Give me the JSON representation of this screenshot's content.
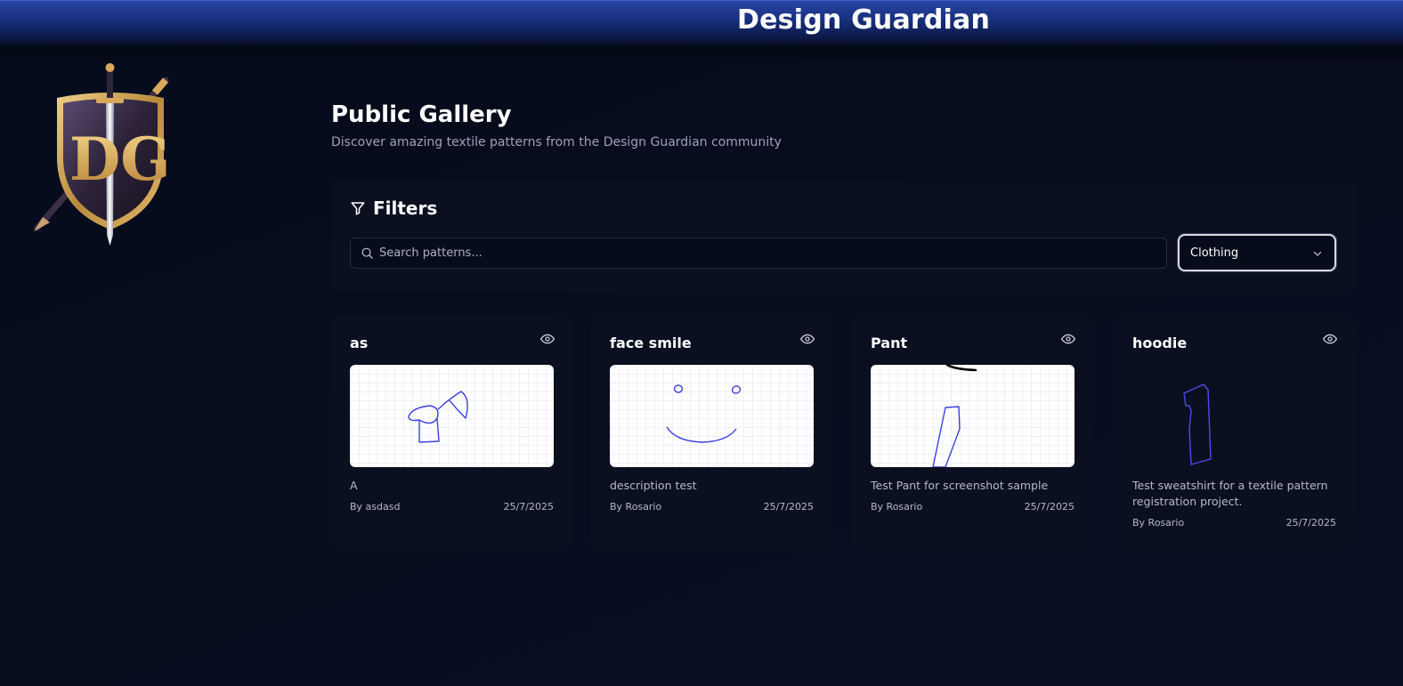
{
  "header": {
    "app_title": "Design Guardian",
    "logo_text": "DG"
  },
  "gallery": {
    "title": "Public Gallery",
    "subtitle": "Discover amazing textile patterns from the Design Guardian community"
  },
  "filters": {
    "title": "Filters",
    "search_placeholder": "Search patterns...",
    "search_value": "",
    "category_selected": "Clothing"
  },
  "patterns": [
    {
      "title": "as",
      "description": "A",
      "author": "By asdasd",
      "date": "25/7/2025"
    },
    {
      "title": "face smile",
      "description": "description test",
      "author": "By Rosario",
      "date": "25/7/2025"
    },
    {
      "title": "Pant",
      "description": "Test Pant for screenshot sample",
      "author": "By Rosario",
      "date": "25/7/2025"
    },
    {
      "title": "hoodie",
      "description": "Test sweatshirt for a textile pattern registration project.",
      "author": "By Rosario",
      "date": "25/7/2025"
    }
  ],
  "icons": {
    "filter": "filter-icon",
    "search": "search-icon",
    "dropdown": "chevron-down-icon",
    "view": "eye-icon"
  },
  "colors": {
    "background": "#070c1c",
    "header_blue": "#1b358a",
    "card": "#0a1020",
    "sketch_stroke": "#3b3fe0",
    "logo_gold": "#d9a85a"
  }
}
